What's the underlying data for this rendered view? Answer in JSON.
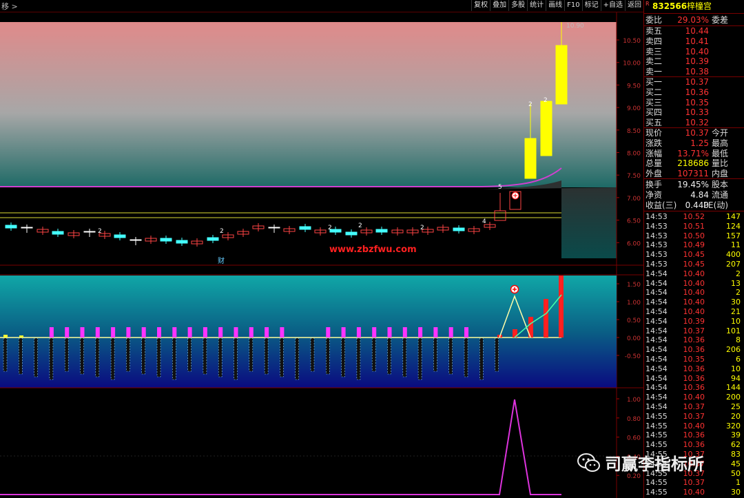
{
  "topbar": {
    "title": "移 >",
    "buttons": [
      "复权",
      "叠加",
      "多股",
      "统计",
      "画线",
      "F10",
      "标记",
      "+自选",
      "返回"
    ]
  },
  "main_chart": {
    "y_ticks": [
      "10.50",
      "10.00",
      "9.50",
      "9.00",
      "8.50",
      "8.00",
      "7.50",
      "7.00",
      "6.50",
      "6.00"
    ],
    "high_label": "10.90",
    "watermark_url": "www.zbzfwu.com",
    "event_label": "财",
    "marks": [
      "2",
      "2",
      "2",
      "2",
      "2",
      "4",
      "5",
      "2",
      "2"
    ]
  },
  "macd": {
    "y_ticks": [
      "1.50",
      "1.00",
      "0.50",
      "0.00",
      "-0.50"
    ]
  },
  "bottom": {
    "y_ticks": [
      "1.00",
      "0.80",
      "0.60",
      "0.40",
      "0.20"
    ]
  },
  "quote": {
    "code": "832566",
    "name": "梓橦宫",
    "r_mark": "R",
    "weibi_label": "委比",
    "weibi": "29.03%",
    "weicha_label": "委差",
    "asks": [
      {
        "label": "卖五",
        "price": "10.44"
      },
      {
        "label": "卖四",
        "price": "10.41"
      },
      {
        "label": "卖三",
        "price": "10.40"
      },
      {
        "label": "卖二",
        "price": "10.39"
      },
      {
        "label": "卖一",
        "price": "10.38"
      }
    ],
    "bids": [
      {
        "label": "买一",
        "price": "10.37"
      },
      {
        "label": "买二",
        "price": "10.36"
      },
      {
        "label": "买三",
        "price": "10.35"
      },
      {
        "label": "买四",
        "price": "10.33"
      },
      {
        "label": "买五",
        "price": "10.32"
      }
    ],
    "stats": [
      {
        "l": "现价",
        "v": "10.37",
        "l2": "今开",
        "c": "red"
      },
      {
        "l": "涨跌",
        "v": "1.25",
        "l2": "最高",
        "c": "red"
      },
      {
        "l": "涨幅",
        "v": "13.71%",
        "l2": "最低",
        "c": "red"
      },
      {
        "l": "总量",
        "v": "218686",
        "l2": "量比",
        "c": "yel"
      },
      {
        "l": "外盘",
        "v": "107311",
        "l2": "内盘",
        "c": "red"
      }
    ],
    "stats2": [
      {
        "l": "换手",
        "v": "19.45%",
        "l2": "股本",
        "c": "white"
      },
      {
        "l": "净资",
        "v": "4.84",
        "l2": "流通",
        "c": "white"
      },
      {
        "l": "收益(三)",
        "v": "0.440",
        "l2": "PE(动)",
        "c": "white"
      }
    ],
    "ticks": [
      [
        "14:53",
        "10.52",
        "147"
      ],
      [
        "14:53",
        "10.51",
        "124"
      ],
      [
        "14:53",
        "10.50",
        "157"
      ],
      [
        "14:53",
        "10.49",
        "11"
      ],
      [
        "14:53",
        "10.45",
        "400"
      ],
      [
        "14:53",
        "10.45",
        "207"
      ],
      [
        "14:54",
        "10.40",
        "2"
      ],
      [
        "14:54",
        "10.40",
        "13"
      ],
      [
        "14:54",
        "10.40",
        "2"
      ],
      [
        "14:54",
        "10.40",
        "30"
      ],
      [
        "14:54",
        "10.40",
        "21"
      ],
      [
        "14:54",
        "10.39",
        "10"
      ],
      [
        "14:54",
        "10.37",
        "101"
      ],
      [
        "14:54",
        "10.36",
        "8"
      ],
      [
        "14:54",
        "10.36",
        "206"
      ],
      [
        "14:54",
        "10.35",
        "6"
      ],
      [
        "14:54",
        "10.36",
        "10"
      ],
      [
        "14:54",
        "10.36",
        "94"
      ],
      [
        "14:54",
        "10.36",
        "144"
      ],
      [
        "14:54",
        "10.40",
        "200"
      ],
      [
        "14:54",
        "10.37",
        "25"
      ],
      [
        "14:55",
        "10.37",
        "20"
      ],
      [
        "14:55",
        "10.40",
        "320"
      ],
      [
        "14:55",
        "10.36",
        "39"
      ],
      [
        "14:55",
        "10.36",
        "62"
      ],
      [
        "14:55",
        "10.37",
        "83"
      ],
      [
        "14:55",
        "10.37",
        "45"
      ],
      [
        "14:55",
        "10.37",
        "50"
      ],
      [
        "14:55",
        "10.37",
        "1"
      ],
      [
        "14:55",
        "10.40",
        "30"
      ]
    ]
  },
  "watermark": {
    "text": "司赢李指标所"
  }
}
